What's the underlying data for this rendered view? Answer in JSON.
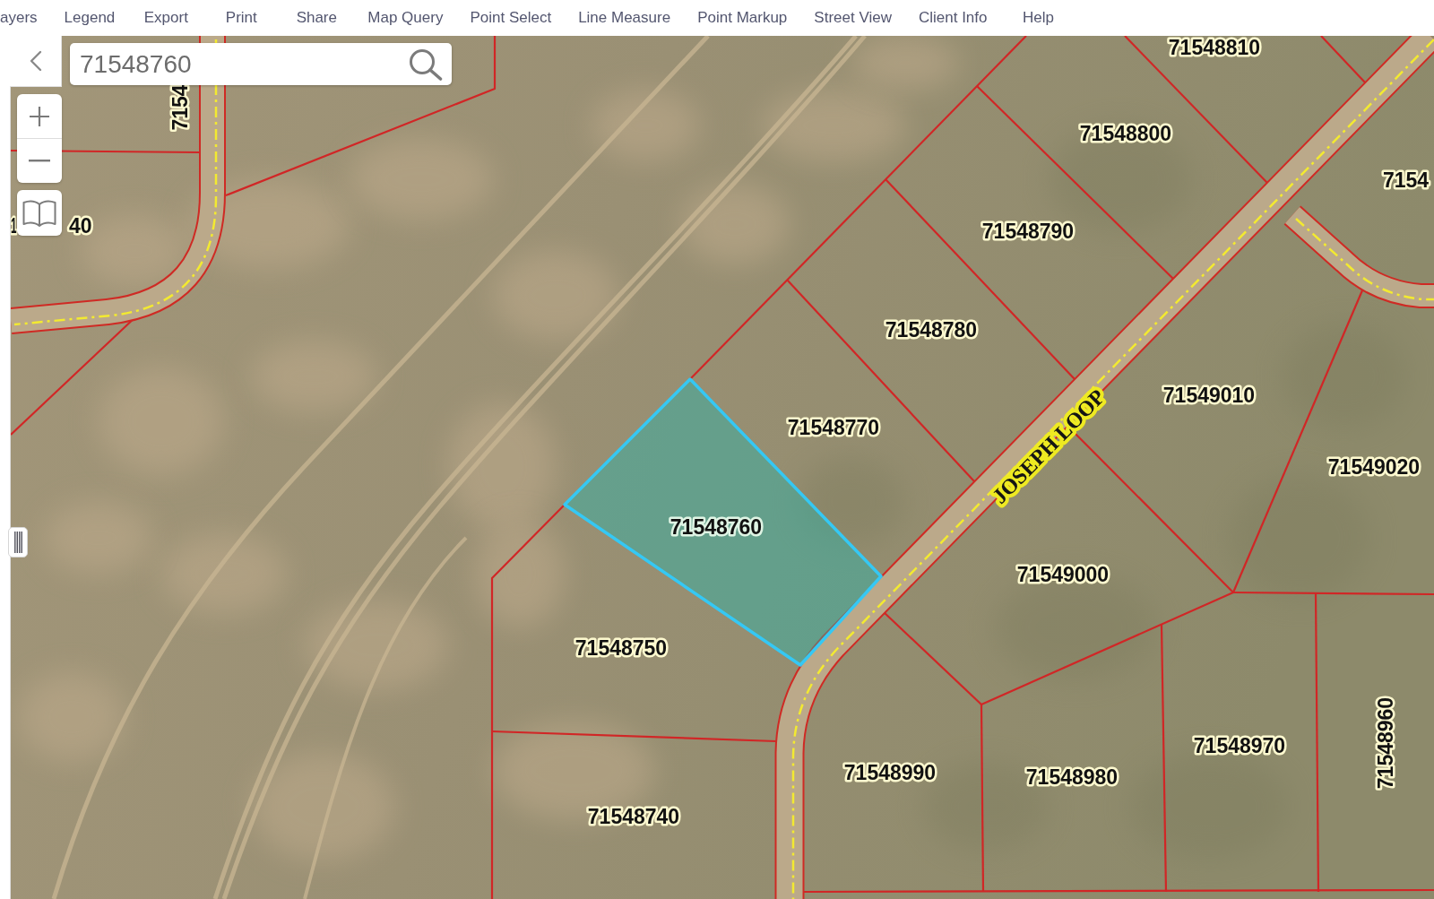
{
  "menu": {
    "items": [
      "ayers",
      "Legend",
      "Export",
      "Print",
      "Share",
      "Map Query",
      "Point Select",
      "Line Measure",
      "Point Markup",
      "Street View",
      "Client Info",
      "Help"
    ]
  },
  "search": {
    "value": "71548760"
  },
  "map": {
    "parcels": [
      {
        "label": "71548810",
        "selected": false
      },
      {
        "label": "7154",
        "selected": false
      },
      {
        "label": "7154",
        "selected": false
      },
      {
        "label": "71548800",
        "selected": false
      },
      {
        "label": "1",
        "selected": false
      },
      {
        "label": "40",
        "selected": false
      },
      {
        "label": "71548790",
        "selected": false
      },
      {
        "label": "71548780",
        "selected": false
      },
      {
        "label": "71549010",
        "selected": false
      },
      {
        "label": "71548770",
        "selected": false
      },
      {
        "label": "71549020",
        "selected": false
      },
      {
        "label": "71548760",
        "selected": true
      },
      {
        "label": "71549000",
        "selected": false
      },
      {
        "label": "71548750",
        "selected": false
      },
      {
        "label": "71548970",
        "selected": false
      },
      {
        "label": "71548960",
        "selected": false
      },
      {
        "label": "71548990",
        "selected": false
      },
      {
        "label": "71548980",
        "selected": false
      },
      {
        "label": "71548740",
        "selected": false
      }
    ],
    "streets": [
      {
        "label": "JOSEPH LOOP"
      }
    ]
  }
}
